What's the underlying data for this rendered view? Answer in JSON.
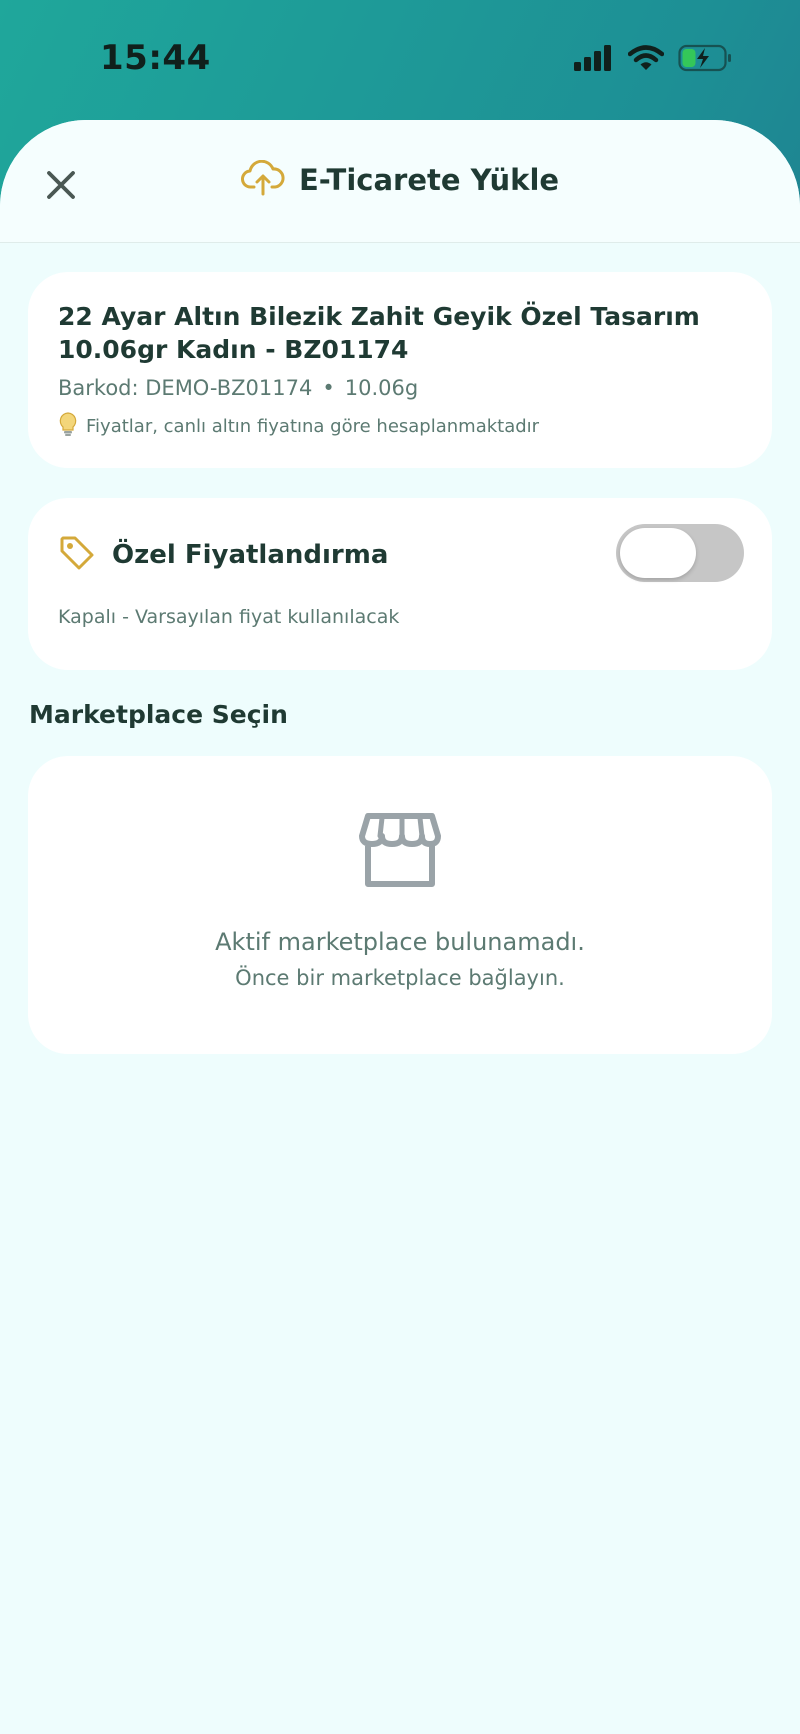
{
  "status_bar": {
    "time": "15:44",
    "icons": [
      "cellular-signal-icon",
      "wifi-icon",
      "battery-charging-icon"
    ]
  },
  "header": {
    "title": "E-Ticarete Yükle",
    "icon": "cloud-upload-icon",
    "close_icon": "close-icon"
  },
  "product": {
    "title": "22 Ayar Altın Bilezik Zahit Geyik Özel Tasarım 10.06gr Kadın - BZ01174",
    "barcode": "Barkod: DEMO-BZ01174",
    "separator": "•",
    "weight": "10.06g",
    "hint": "Fiyatlar, canlı altın fiyatına göre hesaplanmaktadır",
    "hint_icon": "lightbulb-icon"
  },
  "pricing": {
    "title": "Özel Fiyatlandırma",
    "icon": "tag-icon",
    "toggle_on": false,
    "subtitle": "Kapalı - Varsayılan fiyat kullanılacak"
  },
  "marketplace": {
    "section_title": "Marketplace Seçin",
    "empty_icon": "storefront-icon",
    "empty_title": "Aktif marketplace bulunamadı.",
    "empty_subtitle": "Önce bir marketplace bağlayın."
  },
  "colors": {
    "accent_gold": "#d4a93a",
    "text_dark": "#1f3a33",
    "text_muted": "#5c7a72",
    "sheet_bg": "#eefdfd",
    "toggle_off": "#c6c6c6"
  }
}
